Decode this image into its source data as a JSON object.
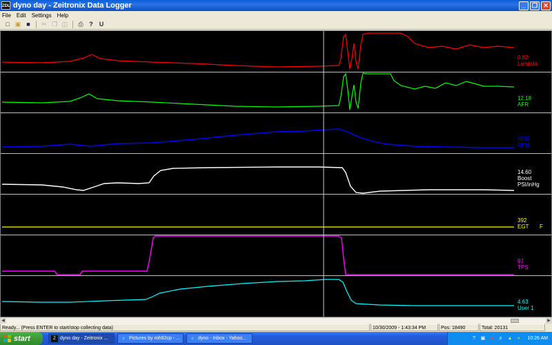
{
  "window": {
    "icon_text": "ZDL",
    "title": "dyno day - Zeitronix Data Logger",
    "buttons": [
      "_",
      "❐",
      "✕"
    ]
  },
  "menu": [
    "File",
    "Edit",
    "Settings",
    "Help"
  ],
  "channels": [
    {
      "id": "lambda",
      "value": "0.82",
      "label": "Lambda",
      "unit": "",
      "color": "#ff0000"
    },
    {
      "id": "afr",
      "value": "12.18",
      "label": "AFR",
      "unit": "",
      "color": "#00ff00"
    },
    {
      "id": "rpm",
      "value": "5930",
      "label": "RPM",
      "unit": "",
      "color": "#0000ff"
    },
    {
      "id": "boost",
      "value": "14.60",
      "label": "Boost",
      "unit": "PSI/inHg",
      "color": "#ffffff"
    },
    {
      "id": "egt",
      "value": "392",
      "label": "EGT",
      "unit": "F",
      "color": "#ffff00"
    },
    {
      "id": "tps",
      "value": "97",
      "label": "TPS",
      "unit": "",
      "color": "#ff00ff"
    },
    {
      "id": "user1",
      "value": "4.63",
      "label": "User 1",
      "unit": "",
      "color": "#00ffff"
    }
  ],
  "status": {
    "message": "Ready... (Press ENTER to start/stop collecting data)",
    "timestamp": "10/30/2009 - 1:43:34 PM",
    "pos": "Pos: 18490",
    "total": "Total: 20131"
  },
  "taskbar": {
    "start_label": "start",
    "items": [
      {
        "label": "dyno day - Zeitronix ...",
        "icon": "zdl-app-icon",
        "active": true
      },
      {
        "label": "Pictures by roh92cp - ...",
        "icon": "ie-icon",
        "active": false
      },
      {
        "label": "dyno - Inbox - Yahoo...",
        "icon": "ie-icon",
        "active": false
      }
    ],
    "lang": "EN",
    "clock": "10:26 AM"
  }
}
